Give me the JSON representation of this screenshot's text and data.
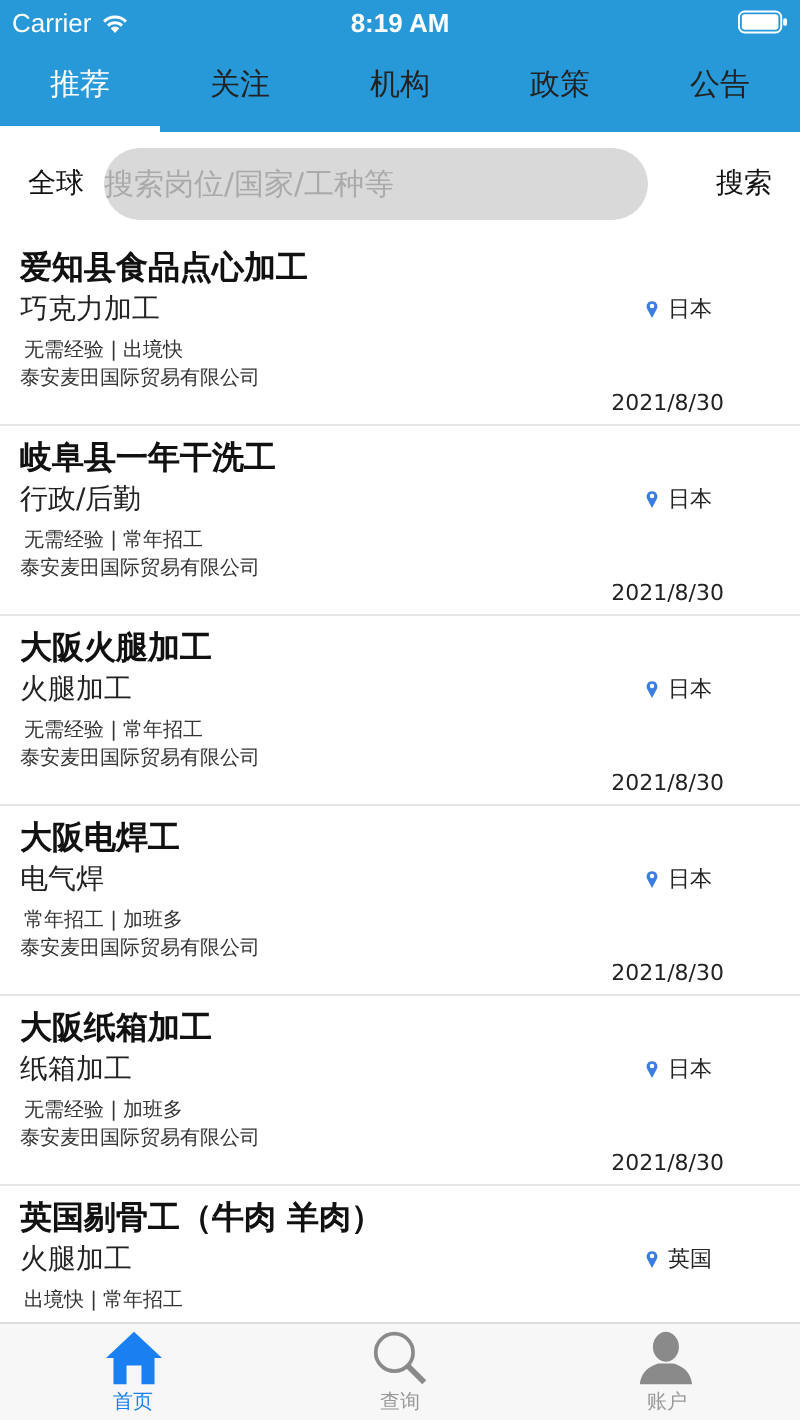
{
  "status_bar": {
    "carrier": "Carrier",
    "time": "8:19 AM"
  },
  "tabs": [
    {
      "label": "推荐",
      "selected": true
    },
    {
      "label": "关注",
      "selected": false
    },
    {
      "label": "机构",
      "selected": false
    },
    {
      "label": "政策",
      "selected": false
    },
    {
      "label": "公告",
      "selected": false
    }
  ],
  "search": {
    "region": "全球",
    "placeholder": "搜索岗位/国家/工种等",
    "button": "搜索"
  },
  "jobs": [
    {
      "title": "爱知县食品点心加工",
      "category": "巧克力加工",
      "location": "日本",
      "tags": "无需经验 | 出境快",
      "company": "泰安麦田国际贸易有限公司",
      "date": "2021/8/30"
    },
    {
      "title": "岐阜县一年干洗工",
      "category": "行政/后勤",
      "location": "日本",
      "tags": "无需经验 | 常年招工",
      "company": "泰安麦田国际贸易有限公司",
      "date": "2021/8/30"
    },
    {
      "title": "大阪火腿加工",
      "category": "火腿加工",
      "location": "日本",
      "tags": "无需经验 | 常年招工",
      "company": "泰安麦田国际贸易有限公司",
      "date": "2021/8/30"
    },
    {
      "title": "大阪电焊工",
      "category": "电气焊",
      "location": "日本",
      "tags": "常年招工 | 加班多",
      "company": "泰安麦田国际贸易有限公司",
      "date": "2021/8/30"
    },
    {
      "title": "大阪纸箱加工",
      "category": "纸箱加工",
      "location": "日本",
      "tags": "无需经验 | 加班多",
      "company": "泰安麦田国际贸易有限公司",
      "date": "2021/8/30"
    },
    {
      "title": "英国剔骨工（牛肉 羊肉）",
      "category": "火腿加工",
      "location": "英国",
      "tags": "出境快 | 常年招工"
    }
  ],
  "bottom_tabs": [
    {
      "label": "首页",
      "kind": "home",
      "selected": true
    },
    {
      "label": "查询",
      "kind": "search",
      "selected": false
    },
    {
      "label": "账户",
      "kind": "account",
      "selected": false
    }
  ]
}
